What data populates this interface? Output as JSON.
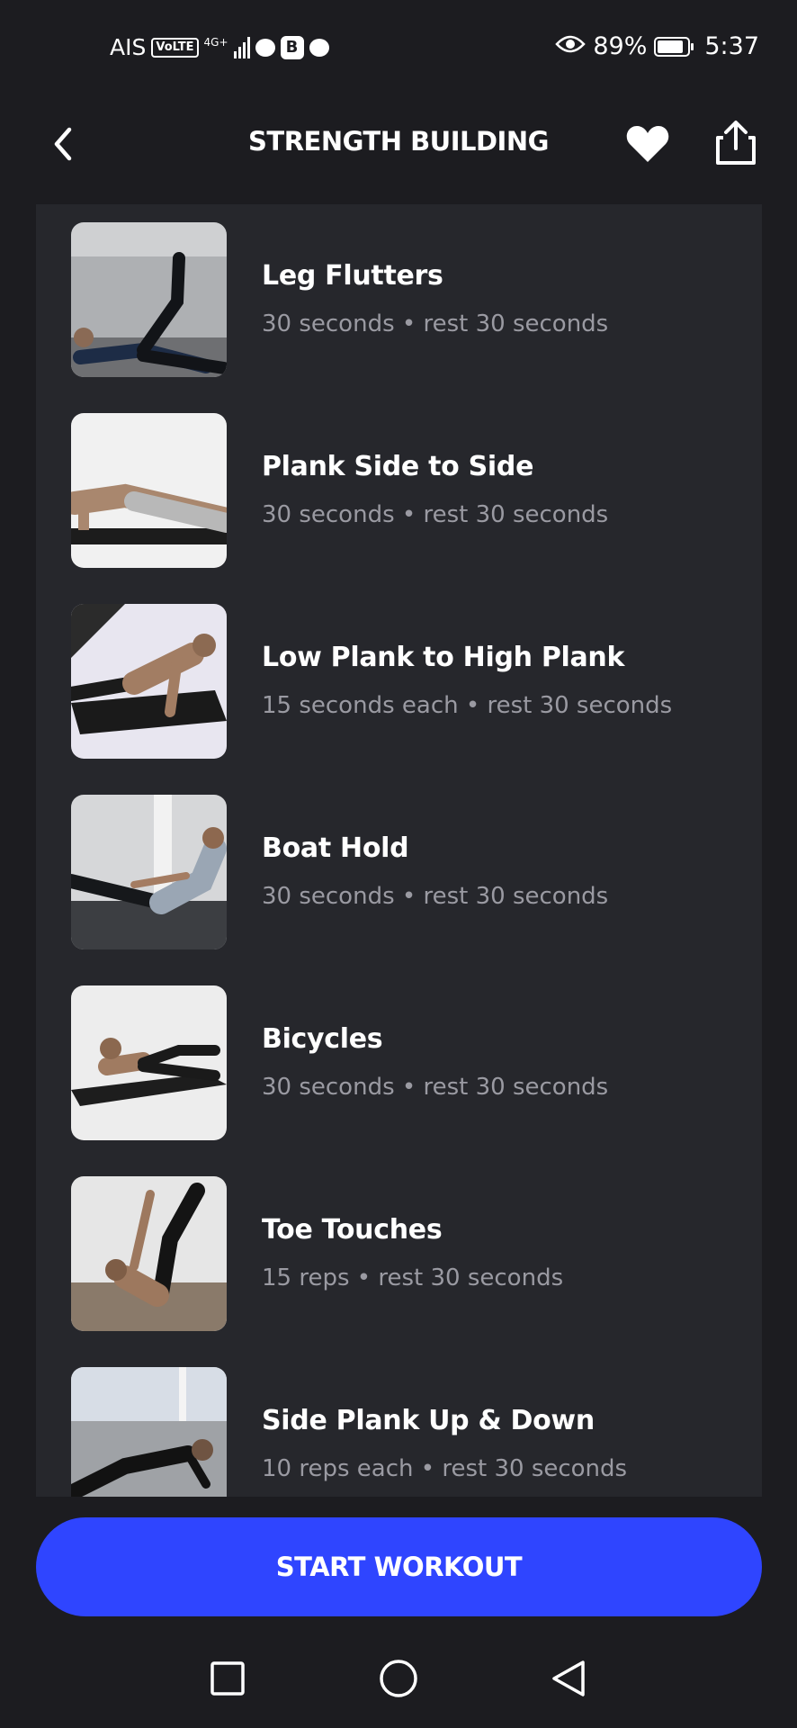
{
  "status_bar": {
    "carrier": "AIS",
    "volte": "VoLTE",
    "network": "4G+",
    "b_badge": "B",
    "battery": "89%",
    "time": "5:37"
  },
  "header": {
    "title": "STRENGTH BUILDING",
    "back_icon": "chevron-left-icon",
    "favorite_icon": "heart-icon",
    "share_icon": "share-icon"
  },
  "exercises": [
    {
      "name": "Leg Flutters",
      "detail": "30 seconds • rest 30 seconds"
    },
    {
      "name": "Plank Side to Side",
      "detail": "30 seconds • rest 30 seconds"
    },
    {
      "name": "Low Plank to High Plank",
      "detail": "15 seconds each • rest 30 seconds"
    },
    {
      "name": "Boat Hold",
      "detail": "30 seconds • rest 30 seconds"
    },
    {
      "name": "Bicycles",
      "detail": "30 seconds • rest 30 seconds"
    },
    {
      "name": "Toe Touches",
      "detail": "15 reps • rest 30 seconds"
    },
    {
      "name": "Side Plank Up & Down",
      "detail": "10 reps each • rest 30 seconds"
    }
  ],
  "start_button": {
    "label": "START WORKOUT"
  },
  "colors": {
    "background": "#1c1c20",
    "panel": "#26272c",
    "accent": "#2f45ff",
    "muted_text": "#9a9aa2"
  },
  "nav_bar": {
    "icons": [
      "recents-square-icon",
      "home-circle-icon",
      "back-triangle-icon"
    ]
  }
}
